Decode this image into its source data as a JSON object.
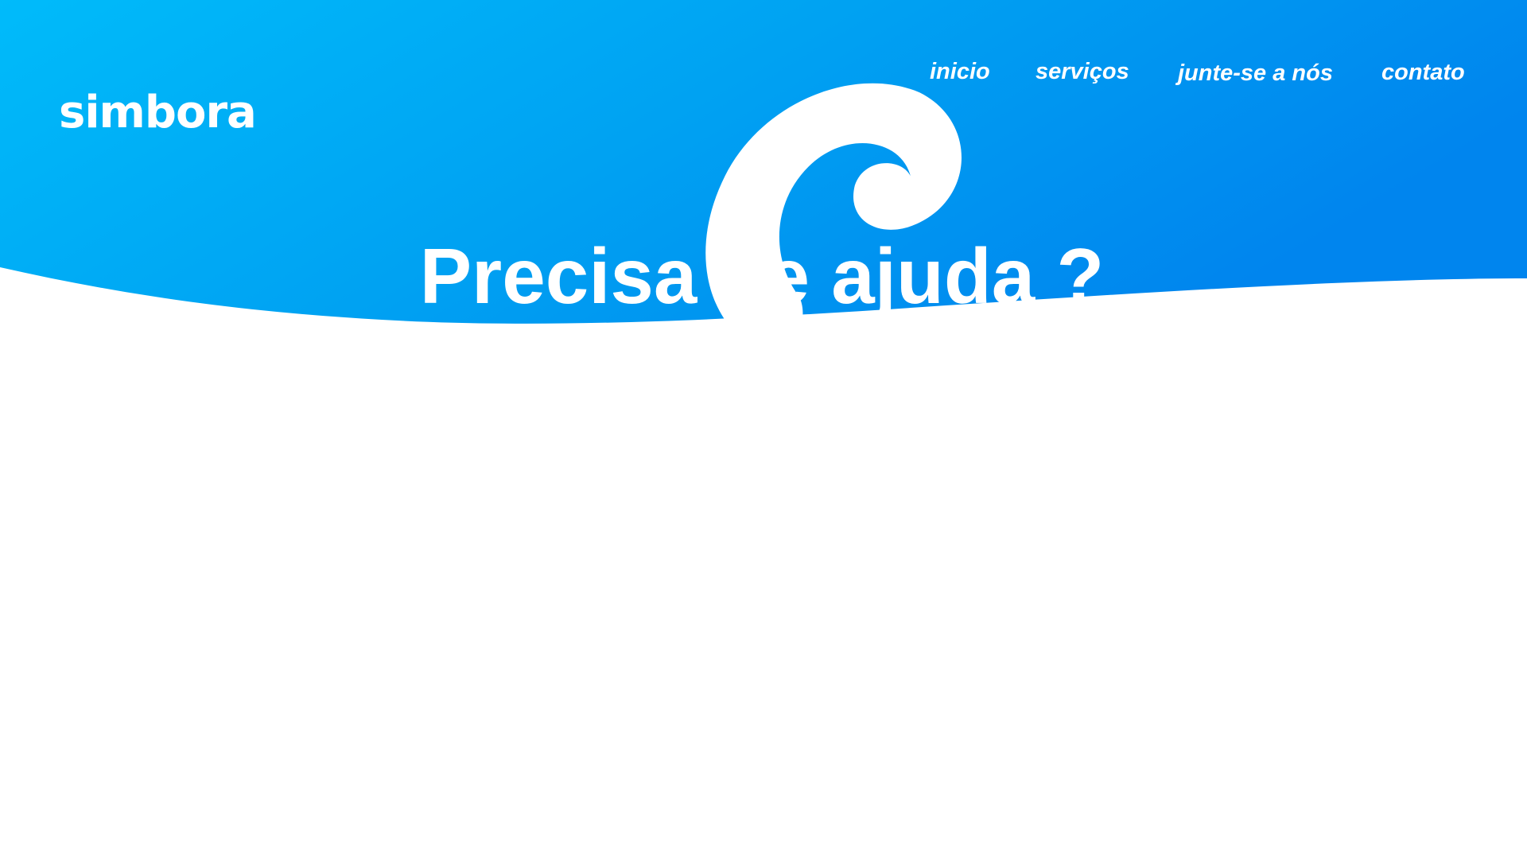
{
  "brand": {
    "name": "simbora",
    "icon": "drop-swirl-icon"
  },
  "nav": {
    "items": [
      {
        "label": "inicio"
      },
      {
        "label": "serviços"
      },
      {
        "label": "junte-se a nós"
      },
      {
        "label": "contato"
      }
    ]
  },
  "hero": {
    "title": "Precisa de ajuda ?"
  },
  "colors": {
    "gradient_start": "#00b8f8",
    "gradient_end": "#0086ef",
    "text": "#ffffff",
    "background": "#ffffff"
  }
}
